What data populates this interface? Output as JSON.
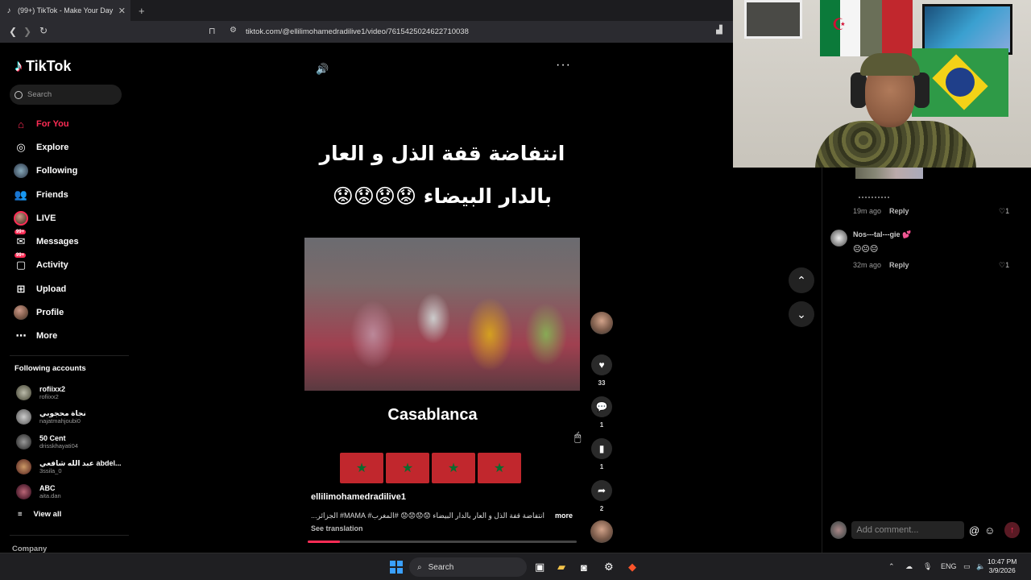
{
  "browser": {
    "tab_title": "(99+) TikTok - Make Your Day",
    "url": "tiktok.com/@ellilimohamedradilive1/video/7615425024622710038"
  },
  "sidebar": {
    "logo": "TikTok",
    "search_placeholder": "Search",
    "nav": [
      {
        "label": "For You",
        "icon": "home-icon",
        "active": true
      },
      {
        "label": "Explore",
        "icon": "compass-icon"
      },
      {
        "label": "Following",
        "icon": "following-avatar-icon"
      },
      {
        "label": "Friends",
        "icon": "friends-icon"
      },
      {
        "label": "LIVE",
        "icon": "live-avatar-icon"
      },
      {
        "label": "Messages",
        "icon": "messages-icon",
        "badge": "99+"
      },
      {
        "label": "Activity",
        "icon": "activity-icon",
        "badge": "99+"
      },
      {
        "label": "Upload",
        "icon": "upload-icon"
      },
      {
        "label": "Profile",
        "icon": "profile-avatar-icon"
      },
      {
        "label": "More",
        "icon": "more-dots-icon"
      }
    ],
    "following_title": "Following accounts",
    "accounts": [
      {
        "name": "rofiixx2",
        "handle": "rofiixx2"
      },
      {
        "name": "نجاة محجوبي",
        "handle": "najatmahjoubi0"
      },
      {
        "name": "50 Cent",
        "handle": "drisskhayati04"
      },
      {
        "name": "عبد الله شافعي abdel...",
        "handle": "3ssila_0"
      },
      {
        "name": "ABC",
        "handle": "aita.dan"
      }
    ],
    "view_all": "View all",
    "company": "Company"
  },
  "video": {
    "title_line1": "انتفاضة قفة الذل و العار",
    "title_line2": "بالدار البيضاء 😟😟😟😟",
    "caption_city": "Casablanca",
    "username": "ellilimohamedradilive1",
    "description": "انتفاضة قفة الذل و العار بالدار البيضاء 😟😟😟😟 #المغرب# MAMA# الجزائر...",
    "more": "more",
    "see_translation": "See translation",
    "progress": 0.12
  },
  "actions": {
    "likes": "33",
    "comments": "1",
    "saves": "1",
    "shares": "2"
  },
  "comments": {
    "c1_time": "19m ago",
    "c1_reply": "Reply",
    "c1_likes": "1",
    "c2_user": "Nos---tal---gie 💕",
    "c2_text": "😐😐😐",
    "c2_time": "32m ago",
    "c2_reply": "Reply",
    "c2_likes": "1",
    "add_placeholder": "Add comment..."
  },
  "taskbar": {
    "search": "Search",
    "lang": "ENG",
    "time": "10:47 PM",
    "date": "3/9/2026"
  },
  "colors": {
    "accent": "#fe2c55",
    "background": "#000000"
  }
}
